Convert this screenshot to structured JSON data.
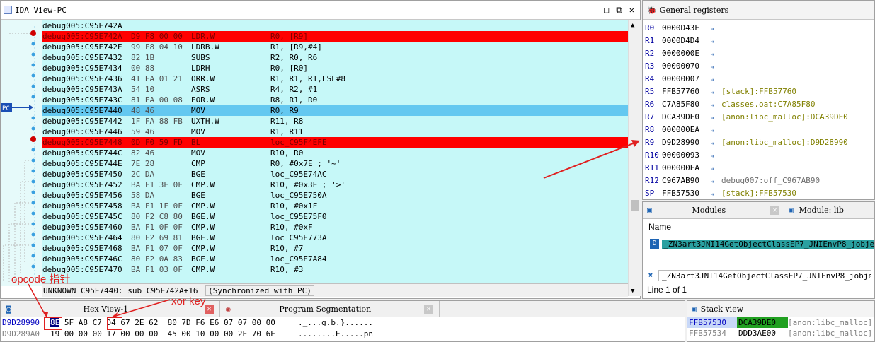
{
  "ida": {
    "title": "IDA View-PC",
    "pc_label": "PC",
    "rows": [
      {
        "addr": "debug005:C95E742A",
        "bytes": "",
        "mn": "",
        "ops": "",
        "type": "label"
      },
      {
        "addr": "debug005:C95E742A",
        "bytes": "D9 F8 00 00",
        "mn": "LDR.W",
        "ops": "R0, [R9]",
        "type": "bp"
      },
      {
        "addr": "debug005:C95E742E",
        "bytes": "99 F8 04 10",
        "mn": "LDRB.W",
        "ops": "R1, [R9,#4]",
        "type": ""
      },
      {
        "addr": "debug005:C95E7432",
        "bytes": "82 1B",
        "mn": "SUBS",
        "ops": "R2, R0, R6",
        "type": ""
      },
      {
        "addr": "debug005:C95E7434",
        "bytes": "00 88",
        "mn": "LDRH",
        "ops": "R0, [R0]",
        "type": ""
      },
      {
        "addr": "debug005:C95E7436",
        "bytes": "41 EA 01 21",
        "mn": "ORR.W",
        "ops": "R1, R1, R1,LSL#8",
        "type": ""
      },
      {
        "addr": "debug005:C95E743A",
        "bytes": "54 10",
        "mn": "ASRS",
        "ops": "R4, R2, #1",
        "type": ""
      },
      {
        "addr": "debug005:C95E743C",
        "bytes": "81 EA 00 08",
        "mn": "EOR.W",
        "ops": "R8, R1, R0",
        "type": ""
      },
      {
        "addr": "debug005:C95E7440",
        "bytes": "48 46",
        "mn": "MOV",
        "ops": "R0, R9",
        "type": "pc"
      },
      {
        "addr": "debug005:C95E7442",
        "bytes": "1F FA 88 FB",
        "mn": "UXTH.W",
        "ops": "R11, R8",
        "type": ""
      },
      {
        "addr": "debug005:C95E7446",
        "bytes": "59 46",
        "mn": "MOV",
        "ops": "R1, R11",
        "type": ""
      },
      {
        "addr": "debug005:C95E7448",
        "bytes": "0D F0 59 FD",
        "mn": "BL",
        "ops": "loc_C95F4EFE",
        "type": "bp"
      },
      {
        "addr": "debug005:C95E744C",
        "bytes": "82 46",
        "mn": "MOV",
        "ops": "R10, R0",
        "type": ""
      },
      {
        "addr": "debug005:C95E744E",
        "bytes": "7E 28",
        "mn": "CMP",
        "ops": "R0, #0x7E ; '~'",
        "type": ""
      },
      {
        "addr": "debug005:C95E7450",
        "bytes": "2C DA",
        "mn": "BGE",
        "ops": "loc_C95E74AC",
        "type": ""
      },
      {
        "addr": "debug005:C95E7452",
        "bytes": "BA F1 3E 0F",
        "mn": "CMP.W",
        "ops": "R10, #0x3E ; '>'",
        "type": ""
      },
      {
        "addr": "debug005:C95E7456",
        "bytes": "58 DA",
        "mn": "BGE",
        "ops": "loc_C95E750A",
        "type": ""
      },
      {
        "addr": "debug005:C95E7458",
        "bytes": "BA F1 1F 0F",
        "mn": "CMP.W",
        "ops": "R10, #0x1F",
        "type": ""
      },
      {
        "addr": "debug005:C95E745C",
        "bytes": "80 F2 C8 80",
        "mn": "BGE.W",
        "ops": "loc_C95E75F0",
        "type": ""
      },
      {
        "addr": "debug005:C95E7460",
        "bytes": "BA F1 0F 0F",
        "mn": "CMP.W",
        "ops": "R10, #0xF",
        "type": ""
      },
      {
        "addr": "debug005:C95E7464",
        "bytes": "80 F2 69 81",
        "mn": "BGE.W",
        "ops": "loc_C95E773A",
        "type": ""
      },
      {
        "addr": "debug005:C95E7468",
        "bytes": "BA F1 07 0F",
        "mn": "CMP.W",
        "ops": "R10, #7",
        "type": ""
      },
      {
        "addr": "debug005:C95E746C",
        "bytes": "80 F2 0A 83",
        "mn": "BGE.W",
        "ops": "loc_C95E7A84",
        "type": ""
      },
      {
        "addr": "debug005:C95E7470",
        "bytes": "BA F1 03 0F",
        "mn": "CMP.W",
        "ops": "R10, #3",
        "type": ""
      }
    ],
    "status": "UNKNOWN C95E7440: sub_C95E742A+16",
    "sync": "(Synchronized with PC)"
  },
  "regs": {
    "title": "General registers",
    "items": [
      {
        "name": "R0",
        "value": "0000D43E",
        "desc": ""
      },
      {
        "name": "R1",
        "value": "0000D4D4",
        "desc": ""
      },
      {
        "name": "R2",
        "value": "0000000E",
        "desc": ""
      },
      {
        "name": "R3",
        "value": "00000070",
        "desc": ""
      },
      {
        "name": "R4",
        "value": "00000007",
        "desc": ""
      },
      {
        "name": "R5",
        "value": "FFB57760",
        "desc": "[stack]:FFB57760"
      },
      {
        "name": "R6",
        "value": "C7A85F80",
        "desc": "classes.oat:C7A85F80"
      },
      {
        "name": "R7",
        "value": "DCA39DE0",
        "desc": "[anon:libc_malloc]:DCA39DE0"
      },
      {
        "name": "R8",
        "value": "000000EA",
        "desc": ""
      },
      {
        "name": "R9",
        "value": "D9D28990",
        "desc": "[anon:libc_malloc]:D9D28990"
      },
      {
        "name": "R10",
        "value": "00000093",
        "desc": ""
      },
      {
        "name": "R11",
        "value": "000000EA",
        "desc": ""
      },
      {
        "name": "R12",
        "value": "C967AB90",
        "desc": "debug007:off_C967AB90"
      },
      {
        "name": "SP",
        "value": "FFB57530",
        "desc": "[stack]:FFB57530"
      }
    ]
  },
  "modules": {
    "tab1": "Modules",
    "tab2": "Module: lib",
    "col_name": "Name",
    "row_name": "_ZN3art3JNI14GetObjectClassEP7_JNIEnvP8_jobject",
    "search_value": "_ZN3art3JNI14GetObjectClassEP7_JNIEnvP8_jobject",
    "line_count": "Line 1 of 1"
  },
  "hex": {
    "tab1": "Hex View-1",
    "tab2": "Program Segmentation",
    "rows": [
      {
        "addr": "D9D28990",
        "first": "8E",
        "rest": " 5F A8 C7 D4 67 2E 62  80 7D F6 E6 07 07 00 00",
        "ascii": "._...g.b.}......"
      },
      {
        "addr": "D9D289A0",
        "first": "19",
        "rest": " 00 00 00 17 00 00 00  45 00 10 00 00 2E 70 6E",
        "ascii": "........E.....pn"
      }
    ]
  },
  "stack": {
    "title": "Stack view",
    "rows": [
      {
        "addr": "FFB57530",
        "value": "DCA39DE0",
        "desc": "[anon:libc_malloc]"
      },
      {
        "addr": "FFB57534",
        "value": "DDD3AE00",
        "desc": "[anon:libc_malloc]"
      }
    ]
  },
  "annotations": {
    "opcode_pointer": "opcode 指针",
    "xor_key": "xor key"
  },
  "colors": {
    "breakpoint": "#ff0000",
    "pc_line": "#64c8f0",
    "listing_bg": "#c6f8f8",
    "annotation": "#e02020"
  }
}
